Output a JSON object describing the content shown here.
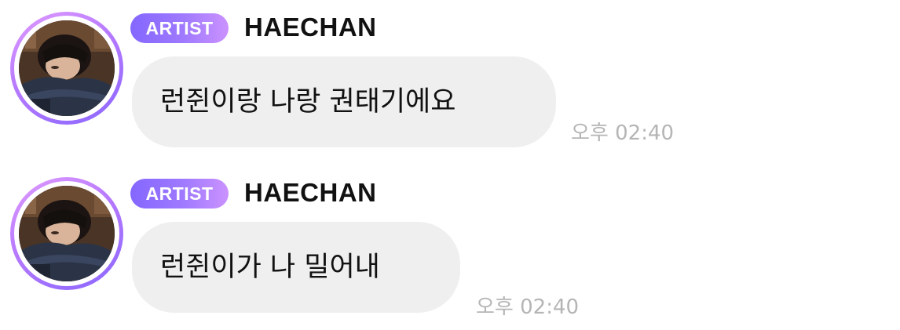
{
  "colors": {
    "badge_gradient_start": "#8467ff",
    "badge_gradient_end": "#cb92ff",
    "avatar_ring": "#b679ff",
    "bubble_background": "#efefef",
    "timestamp_text": "#b5b5b5",
    "name_text": "#111111"
  },
  "messages": [
    {
      "avatar_icon": "profile-photo",
      "badge": "ARTIST",
      "author": "HAECHAN",
      "text": "런쥔이랑 나랑 권태기에요",
      "time": "오후 02:40"
    },
    {
      "avatar_icon": "profile-photo",
      "badge": "ARTIST",
      "author": "HAECHAN",
      "text": "런쥔이가 나 밀어내",
      "time": "오후 02:40"
    }
  ]
}
